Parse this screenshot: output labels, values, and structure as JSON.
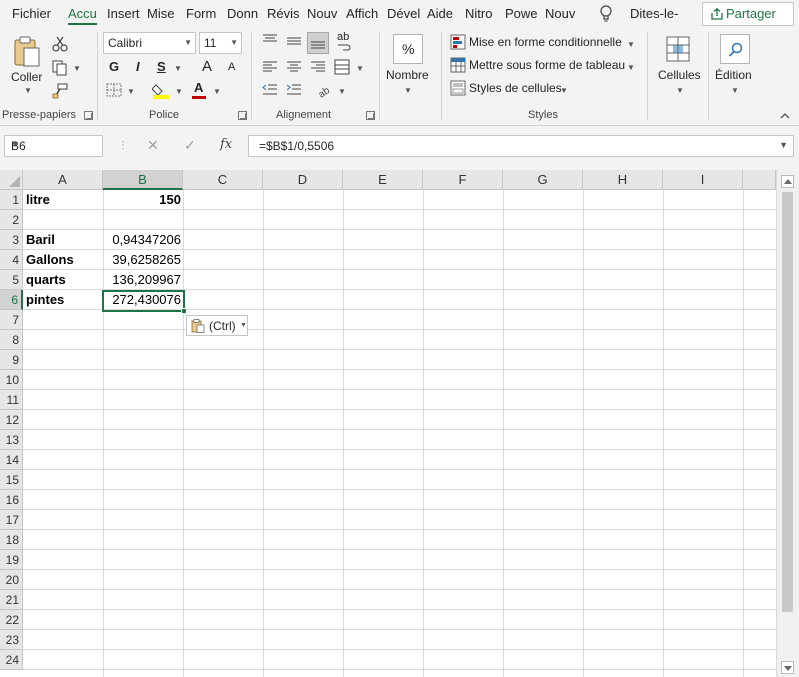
{
  "menu": {
    "tabs": [
      "Fichier",
      "Accu",
      "Insert",
      "Mise",
      "Form",
      "Donn",
      "Révis",
      "Nouv",
      "Affich",
      "Dével",
      "Aide",
      "Nitro",
      "Powe",
      "Nouv"
    ],
    "active_tab": "Accu",
    "tell_me": "Dites-le-",
    "share": "Partager",
    "accent_color": "#217346"
  },
  "ribbon": {
    "clipboard": {
      "paste_label": "Coller",
      "group_label": "Presse-papiers"
    },
    "font": {
      "font_name": "Calibri",
      "font_size": "11",
      "bold": "G",
      "italic": "I",
      "underline": "S",
      "grow": "A",
      "shrink": "A",
      "font_color_glyph": "A",
      "group_label": "Police"
    },
    "alignment": {
      "wrap_glyph": "ab",
      "group_label": "Alignement"
    },
    "number": {
      "percent_glyph": "%",
      "label": "Nombre"
    },
    "styles": {
      "conditional": "Mise en forme conditionnelle",
      "as_table": "Mettre sous forme de tableau",
      "cell_styles": "Styles de cellules",
      "group_label": "Styles"
    },
    "cells": {
      "label": "Cellules"
    },
    "editing": {
      "label": "Édition"
    }
  },
  "formula_bar": {
    "name_box": "B6",
    "fx": "fx",
    "formula": "=$B$1/0,5506"
  },
  "sheet": {
    "columns": [
      "A",
      "B",
      "C",
      "D",
      "E",
      "F",
      "G",
      "H",
      "I"
    ],
    "selected_column": "B",
    "rows": [
      "1",
      "2",
      "3",
      "4",
      "5",
      "6",
      "7",
      "8",
      "9",
      "10",
      "11",
      "12",
      "13",
      "14",
      "15",
      "16",
      "17",
      "18",
      "19",
      "20",
      "21",
      "22",
      "23",
      "24"
    ],
    "selected_row": "6",
    "cells": {
      "A1": "litre",
      "B1": "150",
      "A3": "Baril",
      "B3": "0,94347206",
      "A4": "Gallons",
      "B4": "39,6258265",
      "A5": "quarts",
      "B5": "136,209967",
      "A6": "pintes",
      "B6": "272,430076"
    },
    "paste_options": "(Ctrl)"
  }
}
